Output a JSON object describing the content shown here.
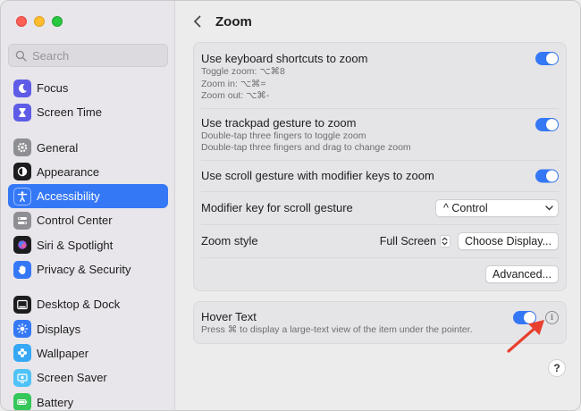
{
  "sidebar": {
    "search_placeholder": "Search",
    "items": [
      {
        "label": "Focus",
        "icon": "moon-icon",
        "color": "#5e5ce6"
      },
      {
        "label": "Screen Time",
        "icon": "hourglass-icon",
        "color": "#5e5ce6"
      },
      {
        "label": "General",
        "icon": "gear-icon",
        "color": "#8e8e93"
      },
      {
        "label": "Appearance",
        "icon": "appearance-icon",
        "color": "#1d1d1f"
      },
      {
        "label": "Accessibility",
        "icon": "accessibility-icon",
        "color": "#3478f6"
      },
      {
        "label": "Control Center",
        "icon": "control-center-icon",
        "color": "#8e8e93"
      },
      {
        "label": "Siri & Spotlight",
        "icon": "siri-icon",
        "color": "#1d1d1f"
      },
      {
        "label": "Privacy & Security",
        "icon": "hand-icon",
        "color": "#3478f6"
      },
      {
        "label": "Desktop & Dock",
        "icon": "dock-icon",
        "color": "#1d1d1f"
      },
      {
        "label": "Displays",
        "icon": "sun-icon",
        "color": "#3478f6"
      },
      {
        "label": "Wallpaper",
        "icon": "flower-icon",
        "color": "#37a8f5"
      },
      {
        "label": "Screen Saver",
        "icon": "screen-saver-icon",
        "color": "#4fc3f7"
      },
      {
        "label": "Battery",
        "icon": "battery-icon",
        "color": "#34c759"
      }
    ],
    "active": "Accessibility"
  },
  "header": {
    "title": "Zoom"
  },
  "zoom_group": {
    "keyboard": {
      "label": "Use keyboard shortcuts to zoom",
      "line1": "Toggle zoom: ⌥⌘8",
      "line2": "Zoom in: ⌥⌘=",
      "line3": "Zoom out: ⌥⌘-",
      "enabled": true
    },
    "trackpad": {
      "label": "Use trackpad gesture to zoom",
      "line1": "Double-tap three fingers to toggle zoom",
      "line2": "Double-tap three fingers and drag to change zoom",
      "enabled": true
    },
    "scroll": {
      "label": "Use scroll gesture with modifier keys to zoom",
      "enabled": true
    },
    "modifier": {
      "label": "Modifier key for scroll gesture",
      "value": "^ Control"
    },
    "style": {
      "label": "Zoom style",
      "value": "Full Screen",
      "button": "Choose Display..."
    },
    "advanced_button": "Advanced..."
  },
  "hover_group": {
    "label": "Hover Text",
    "description": "Press ⌘ to display a large-text view of the item under the pointer.",
    "enabled": true,
    "info": "i"
  },
  "help_label": "?",
  "annotation_color": "#e8402f"
}
